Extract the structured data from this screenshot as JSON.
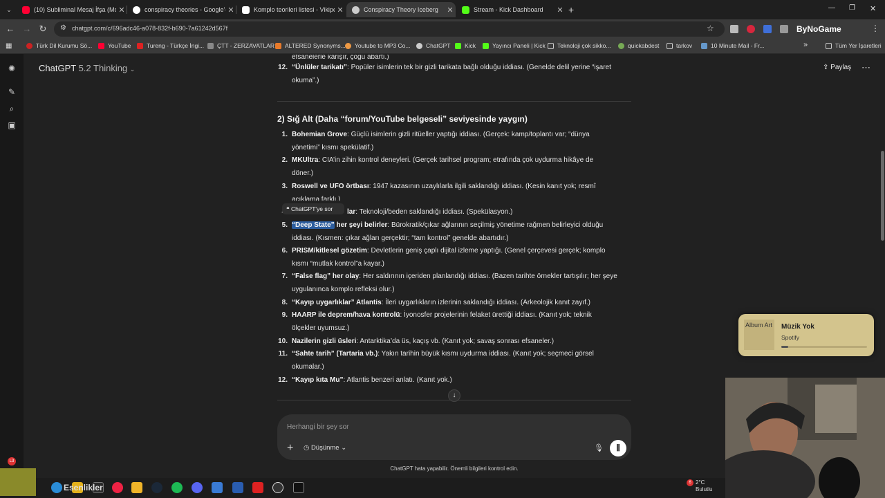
{
  "tabs": [
    {
      "title": "(10) Subliminal Mesaj İfşa (Mo",
      "icon": "youtube-icon",
      "color": "#ff0033"
    },
    {
      "title": "conspiracy theories - Google'da",
      "icon": "google-icon",
      "color": "#4285f4"
    },
    {
      "title": "Komplo teorileri listesi - Vikipe",
      "icon": "wikipedia-icon",
      "color": "#ffffff"
    },
    {
      "title": "Conspiracy Theory Iceberg",
      "icon": "chatgpt-icon",
      "color": "#cccccc"
    },
    {
      "title": "Stream - Kick Dashboard",
      "icon": "kick-icon",
      "color": "#53fc18"
    }
  ],
  "new_tab": "+",
  "address": {
    "url": "chatgpt.com/c/696adc46-a078-832f-b690-7a61242d567f"
  },
  "extension_label": "ByNoGame",
  "bookmarks": [
    "Türk Dil Kurumu Sö...",
    "YouTube",
    "Tureng - Türkçe İngi...",
    "ÇTT - ZERZAVATLAR",
    "ALTERED Synonyms...",
    "Youtube to MP3 Co...",
    "ChatGPT",
    "Kick",
    "Yayıncı Paneli | Kick",
    "Teknoloji çok sikko...",
    "quickabdest",
    "tarkov",
    "10 Minute Mail - Fr..."
  ],
  "bookmarks_more": "»",
  "all_bookmarks": "Tüm Yer İşaretleri",
  "header": {
    "model": "ChatGPT",
    "version": "5.2 Thinking",
    "share": "Paylaş",
    "more": "⋯"
  },
  "top": {
    "clipped_line": "efsanelerle karışır, çoğu abartı.)",
    "item12_num": "12.",
    "item12_title": "“Ünlüler tarikatı”",
    "item12_text": ": Popüler isimlerin tek bir gizli tarikata bağlı olduğu iddiası. (Genelde delil yerine “işaret",
    "item12_cont": "okuma”.)"
  },
  "section_title": "2) Sığ Alt (Daha “forum/YouTube belgeseli” seviyesinde yaygın)",
  "items": [
    {
      "num": "1.",
      "title": "Bohemian Grove",
      "text": ": Güçlü isimlerin gizli ritüeller yaptığı iddiası. (Gerçek: kamp/toplantı var; “dünya",
      "cont": "yönetimi” kısmı spekülatif.)"
    },
    {
      "num": "2.",
      "title": "MKUltra",
      "text": ": CIA’in zihin kontrol deneyleri. (Gerçek tarihsel program; etrafında çok uydurma hikâye de",
      "cont": "döner.)"
    },
    {
      "num": "3.",
      "title": "Roswell ve UFO örtbası",
      "text": ": 1947 kazasının uzaylılarla ilgili saklandığı iddiası. (Kesin kanıt yok; resmî",
      "cont": "açıklama farklı.)"
    },
    {
      "num": "4.",
      "title": "lar",
      "text": ": Teknoloji/beden saklandığı iddiası. (Spekülasyon.)",
      "cont": ""
    },
    {
      "num": "5.",
      "title": "“Deep State”",
      "title2": " her şeyi belirler",
      "text": ": Bürokratik/çıkar ağlarının seçilmiş yönetime rağmen belirleyici olduğu",
      "cont": "iddiası. (Kısmen: çıkar ağları gerçektir; “tam kontrol” genelde abartıdır.)"
    },
    {
      "num": "6.",
      "title": "PRISM/kitlesel gözetim",
      "text": ": Devletlerin geniş çaplı dijital izleme yaptığı. (Genel çerçevesi gerçek; komplo",
      "cont": "kısmı “mutlak kontrol”a kayar.)"
    },
    {
      "num": "7.",
      "title": "“False flag” her olay",
      "text": ": Her saldırının içeriden planlandığı iddiası. (Bazen tarihte örnekler tartışılır; her şeye",
      "cont": "uygulanınca komplo refleksi olur.)"
    },
    {
      "num": "8.",
      "title": "“Kayıp uygarlıklar” Atlantis",
      "text": ": İleri uygarlıkların izlerinin saklandığı iddiası. (Arkeolojik kanıt zayıf.)",
      "cont": ""
    },
    {
      "num": "9.",
      "title": "HAARP ile deprem/hava kontrolü",
      "text": ": İyonosfer projelerinin felaket ürettiği iddiası. (Kanıt yok; teknik",
      "cont": "ölçekler uyumsuz.)"
    },
    {
      "num": "10.",
      "title": "Nazilerin gizli üsleri",
      "text": ": Antarktika’da üs, kaçış vb. (Kanıt yok; savaş sonrası efsaneler.)",
      "cont": ""
    },
    {
      "num": "11.",
      "title": "“Sahte tarih” (Tartaria vb.)",
      "text": ": Yakın tarihin büyük kısmı uydurma iddiası. (Kanıt yok; seçmeci görsel",
      "cont": "okumalar.)"
    },
    {
      "num": "12.",
      "title": "“Kayıp kıta Mu”",
      "text": ": Atlantis benzeri anlatı. (Kanıt yok.)",
      "cont": ""
    }
  ],
  "tooltip": "ChatGPT'ye sor",
  "composer": {
    "placeholder": "Herhangi bir şey sor",
    "mode": "Düşünme",
    "plus": "+"
  },
  "disclaimer": "ChatGPT hata yapabilir. Önemli bilgileri kontrol edin.",
  "spotify": {
    "art_alt": "Album Art",
    "title": "Müzik Yok",
    "app": "Spotify",
    "progress": 0.08
  },
  "taskbar": {
    "greeting": "Esenlikler",
    "temp": "2°C",
    "weather": "Bulutlu",
    "badge": "6"
  }
}
